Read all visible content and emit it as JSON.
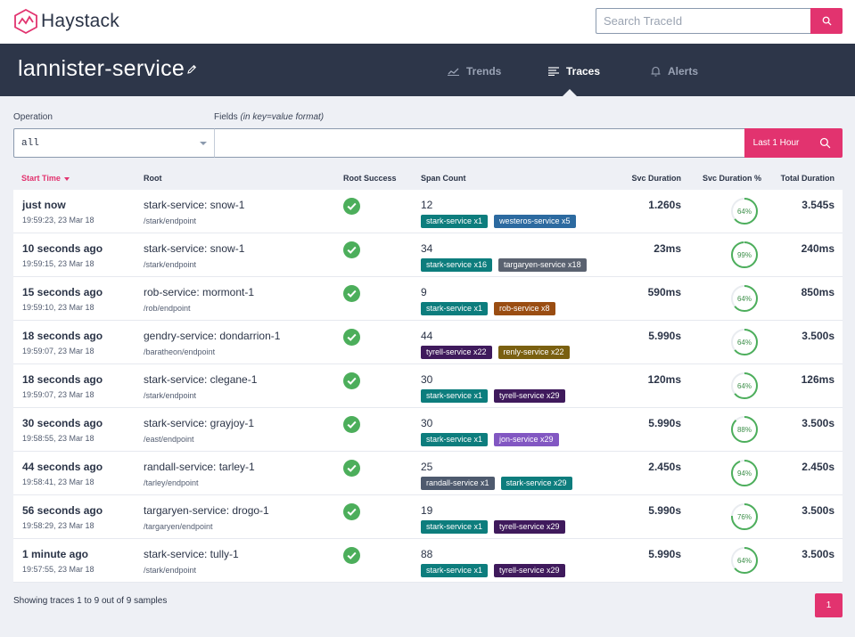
{
  "app": {
    "name": "Haystack"
  },
  "search": {
    "placeholder": "Search TraceId"
  },
  "service": {
    "name": "lannister-service"
  },
  "tabs": [
    {
      "label": "Trends",
      "icon": "trends-icon",
      "active": false
    },
    {
      "label": "Traces",
      "icon": "list-icon",
      "active": true
    },
    {
      "label": "Alerts",
      "icon": "bell-icon",
      "active": false
    }
  ],
  "filters": {
    "operation_label": "Operation",
    "operation_value": "all",
    "fields_label": "Fields",
    "fields_hint": "(in key=value format)",
    "fields_value": "",
    "time_range": "Last 1 Hour"
  },
  "columns": {
    "start_time": "Start Time",
    "root": "Root",
    "root_success": "Root Success",
    "span_count": "Span Count",
    "svc_duration": "Svc Duration",
    "svc_duration_pct": "Svc Duration %",
    "total_duration": "Total Duration"
  },
  "colors": {
    "accent": "#e2336f",
    "header_dark": "#2d3649",
    "success": "#4cae5b",
    "stark": "#0d7d7d",
    "westeros": "#2c6aa0",
    "targaryen": "#5a6270",
    "rob": "#9a4d12",
    "tyrell": "#3f1a5c",
    "renly": "#7a6010",
    "jon": "#8257c2",
    "randall": "#4e5a6e"
  },
  "traces": [
    {
      "start_relative": "just now",
      "start_absolute": "19:59:23, 23 Mar 18",
      "root_op": "stark-service: snow-1",
      "root_url": "/stark/endpoint",
      "span_count": "12",
      "services": [
        {
          "label": "stark-service x1",
          "color": "#0d7d7d"
        },
        {
          "label": "westeros-service x5",
          "color": "#2c6aa0"
        }
      ],
      "svc_duration": "1.260s",
      "svc_pct": 64,
      "svc_pct_label": "64%",
      "total_duration": "3.545s"
    },
    {
      "start_relative": "10 seconds ago",
      "start_absolute": "19:59:15, 23 Mar 18",
      "root_op": "stark-service: snow-1",
      "root_url": "/stark/endpoint",
      "span_count": "34",
      "services": [
        {
          "label": "stark-service x16",
          "color": "#0d7d7d"
        },
        {
          "label": "targaryen-service x18",
          "color": "#5a6270"
        }
      ],
      "svc_duration": "23ms",
      "svc_pct": 99,
      "svc_pct_label": "99%",
      "total_duration": "240ms"
    },
    {
      "start_relative": "15 seconds ago",
      "start_absolute": "19:59:10, 23 Mar 18",
      "root_op": "rob-service: mormont-1",
      "root_url": "/rob/endpoint",
      "span_count": "9",
      "services": [
        {
          "label": "stark-service x1",
          "color": "#0d7d7d"
        },
        {
          "label": "rob-service x8",
          "color": "#9a4d12"
        }
      ],
      "svc_duration": "590ms",
      "svc_pct": 64,
      "svc_pct_label": "64%",
      "total_duration": "850ms"
    },
    {
      "start_relative": "18 seconds ago",
      "start_absolute": "19:59:07, 23 Mar 18",
      "root_op": "gendry-service: dondarrion-1",
      "root_url": "/baratheon/endpoint",
      "span_count": "44",
      "services": [
        {
          "label": "tyrell-service x22",
          "color": "#3f1a5c"
        },
        {
          "label": "renly-service x22",
          "color": "#7a6010"
        }
      ],
      "svc_duration": "5.990s",
      "svc_pct": 64,
      "svc_pct_label": "64%",
      "total_duration": "3.500s"
    },
    {
      "start_relative": "18 seconds ago",
      "start_absolute": "19:59:07, 23 Mar 18",
      "root_op": "stark-service: clegane-1",
      "root_url": "/stark/endpoint",
      "span_count": "30",
      "services": [
        {
          "label": "stark-service x1",
          "color": "#0d7d7d"
        },
        {
          "label": "tyrell-service x29",
          "color": "#3f1a5c"
        }
      ],
      "svc_duration": "120ms",
      "svc_pct": 64,
      "svc_pct_label": "64%",
      "total_duration": "126ms"
    },
    {
      "start_relative": "30 seconds ago",
      "start_absolute": "19:58:55, 23 Mar 18",
      "root_op": "stark-service: grayjoy-1",
      "root_url": "/east/endpoint",
      "span_count": "30",
      "services": [
        {
          "label": "stark-service x1",
          "color": "#0d7d7d"
        },
        {
          "label": "jon-service x29",
          "color": "#8257c2"
        }
      ],
      "svc_duration": "5.990s",
      "svc_pct": 88,
      "svc_pct_label": "88%",
      "total_duration": "3.500s"
    },
    {
      "start_relative": "44 seconds ago",
      "start_absolute": "19:58:41, 23 Mar 18",
      "root_op": "randall-service: tarley-1",
      "root_url": "/tarley/endpoint",
      "span_count": "25",
      "services": [
        {
          "label": "randall-service x1",
          "color": "#4e5a6e"
        },
        {
          "label": "stark-service x29",
          "color": "#0d7d7d"
        }
      ],
      "svc_duration": "2.450s",
      "svc_pct": 94,
      "svc_pct_label": "94%",
      "total_duration": "2.450s"
    },
    {
      "start_relative": "56 seconds ago",
      "start_absolute": "19:58:29, 23 Mar 18",
      "root_op": "targaryen-service: drogo-1",
      "root_url": "/targaryen/endpoint",
      "span_count": "19",
      "services": [
        {
          "label": "stark-service x1",
          "color": "#0d7d7d"
        },
        {
          "label": "tyrell-service x29",
          "color": "#3f1a5c"
        }
      ],
      "svc_duration": "5.990s",
      "svc_pct": 76,
      "svc_pct_label": "76%",
      "total_duration": "3.500s"
    },
    {
      "start_relative": "1 minute ago",
      "start_absolute": "19:57:55, 23 Mar 18",
      "root_op": "stark-service: tully-1",
      "root_url": "/stark/endpoint",
      "span_count": "88",
      "services": [
        {
          "label": "stark-service x1",
          "color": "#0d7d7d"
        },
        {
          "label": "tyrell-service x29",
          "color": "#3f1a5c"
        }
      ],
      "svc_duration": "5.990s",
      "svc_pct": 64,
      "svc_pct_label": "64%",
      "total_duration": "3.500s"
    }
  ],
  "footer": {
    "summary": "Showing traces 1 to 9 out of 9 samples",
    "page": "1"
  }
}
